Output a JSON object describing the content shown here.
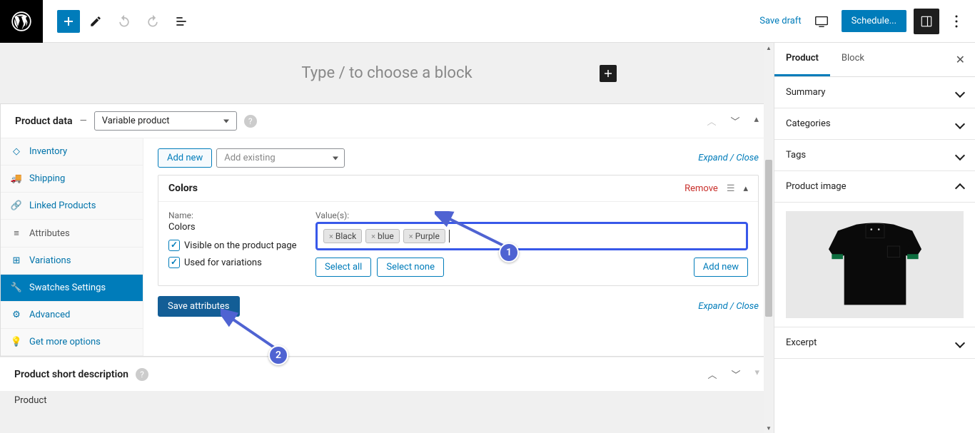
{
  "topbar": {
    "save_draft": "Save draft",
    "schedule": "Schedule..."
  },
  "canvas": {
    "placeholder": "Type / to choose a block"
  },
  "product_data": {
    "title": "Product data",
    "dash": "—",
    "type_selected": "Variable product",
    "tabs": [
      {
        "icon": "inventory",
        "label": "Inventory"
      },
      {
        "icon": "shipping",
        "label": "Shipping"
      },
      {
        "icon": "linked",
        "label": "Linked Products"
      },
      {
        "icon": "attributes",
        "label": "Attributes"
      },
      {
        "icon": "variations",
        "label": "Variations"
      },
      {
        "icon": "swatches",
        "label": "Swatches Settings"
      },
      {
        "icon": "advanced",
        "label": "Advanced"
      },
      {
        "icon": "more",
        "label": "Get more options"
      }
    ],
    "add_new": "Add new",
    "add_existing_placeholder": "Add existing",
    "expand_collapse": "Expand / Close",
    "attribute": {
      "title": "Colors",
      "remove": "Remove",
      "name_label": "Name:",
      "name_value": "Colors",
      "visible_label": "Visible on the product page",
      "used_label": "Used for variations",
      "values_label": "Value(s):",
      "tags": [
        "Black",
        "blue",
        "Purple"
      ],
      "select_all": "Select all",
      "select_none": "Select none",
      "add_new_value": "Add new"
    },
    "save_attributes": "Save attributes",
    "short_desc_title": "Product short description",
    "footer_label": "Product"
  },
  "annotations": {
    "badge1": "1",
    "badge2": "2"
  },
  "sidebar": {
    "tabs": [
      {
        "label": "Product",
        "active": true
      },
      {
        "label": "Block",
        "active": false
      }
    ],
    "sections": {
      "summary": "Summary",
      "categories": "Categories",
      "tags": "Tags",
      "product_image": "Product image",
      "excerpt": "Excerpt"
    }
  }
}
